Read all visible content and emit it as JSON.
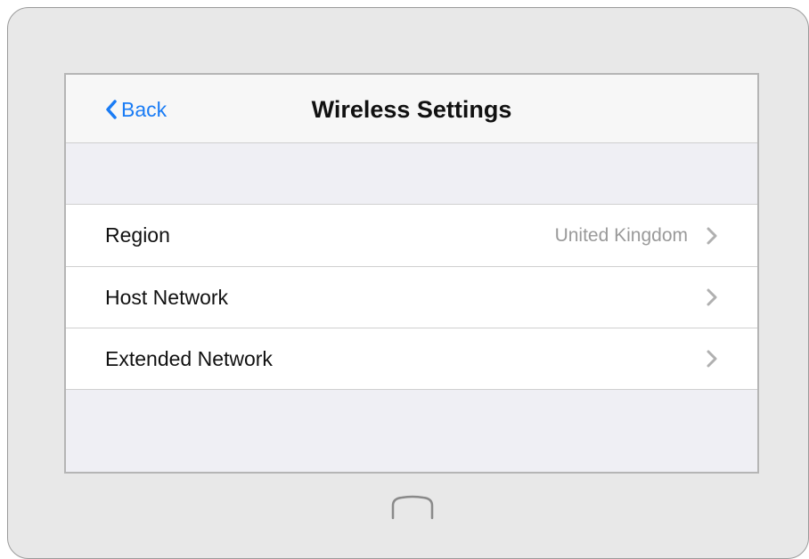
{
  "navbar": {
    "back_label": "Back",
    "title": "Wireless Settings"
  },
  "settings": {
    "rows": [
      {
        "label": "Region",
        "value": "United Kingdom"
      },
      {
        "label": "Host Network",
        "value": ""
      },
      {
        "label": "Extended Network",
        "value": ""
      }
    ]
  },
  "icons": {
    "back": "chevron-left-icon",
    "disclosure": "chevron-right-icon",
    "home": "home-button-icon"
  },
  "colors": {
    "accent": "#1a7cf5",
    "secondary_text": "#9a9a9a",
    "device_frame": "#e8e8e8"
  }
}
